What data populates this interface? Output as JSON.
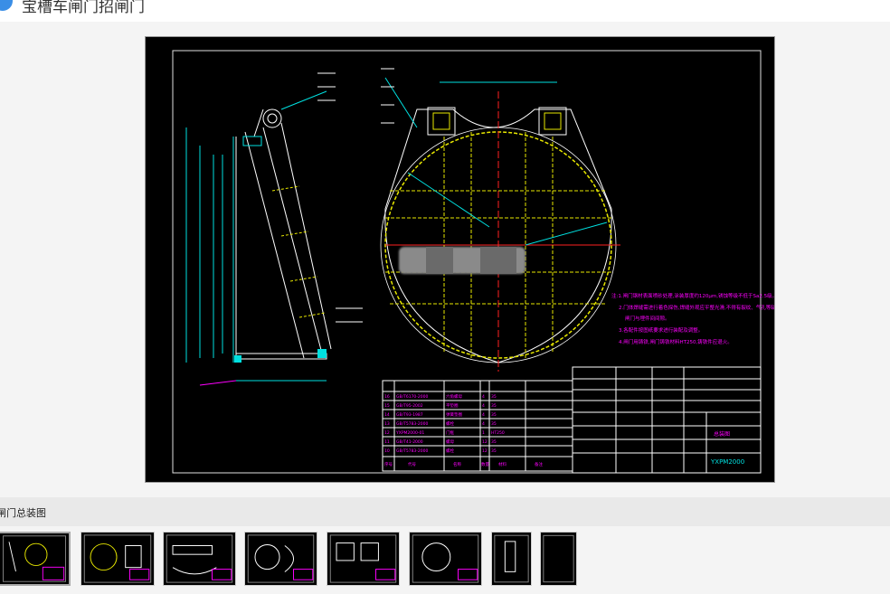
{
  "header": {
    "title": "宝槽车闸门招闸门",
    "logo_icon": "circle-logo-icon"
  },
  "drawing": {
    "notes": [
      "注:1.闸门钢材表面喷砂处理,涂装厚度约120μm,锈蚀等级不低于Sa2.5级。",
      "2.门体焊缝需进行着色探伤,焊缝外观应平整光滑,不得有裂纹、气孔等缺陷。",
      "闸门与埋件间间隙。",
      "3.各配件按图纸要求进行装配及调整。",
      "4.闸门用铸铁,闸门铸铁材料HT250,铸铁件应退火。"
    ],
    "drawing_no": "YXPM2000",
    "sheet_title": "总装图",
    "bom_rows": [
      [
        "16",
        "GB/T6170-2000",
        "六角螺母",
        "4",
        "35"
      ],
      [
        "15",
        "GB/T95-2002",
        "平垫圈",
        "4",
        "35"
      ],
      [
        "14",
        "GB/T93-1987",
        "弹簧垫圈",
        "4",
        "35"
      ],
      [
        "13",
        "GB/T5783-2000",
        "螺栓",
        "4",
        "35"
      ],
      [
        "12",
        "YXPM2000-01",
        "门框",
        "1",
        "HT250"
      ],
      [
        "11",
        "GB/T41-2000",
        "螺母",
        "12",
        "35"
      ],
      [
        "10",
        "GB/T5783-2000",
        "螺栓",
        "12",
        "35"
      ]
    ],
    "bom_headers": [
      "序号",
      "代号",
      "名称",
      "数量",
      "材料",
      "备注"
    ]
  },
  "caption": {
    "text": "闸门总装图"
  },
  "thumbnails": [
    {
      "label": "thumbnail-1"
    },
    {
      "label": "thumbnail-2"
    },
    {
      "label": "thumbnail-3"
    },
    {
      "label": "thumbnail-4"
    },
    {
      "label": "thumbnail-5"
    },
    {
      "label": "thumbnail-6"
    },
    {
      "label": "thumbnail-7"
    },
    {
      "label": "thumbnail-8"
    }
  ],
  "colors": {
    "frame": "#00e0e0",
    "gate_outline": "#ffffff",
    "grid": "#e8e800",
    "dim": "#00e0e0",
    "notes": "#ff00ff",
    "accent_red": "#ff2020"
  }
}
